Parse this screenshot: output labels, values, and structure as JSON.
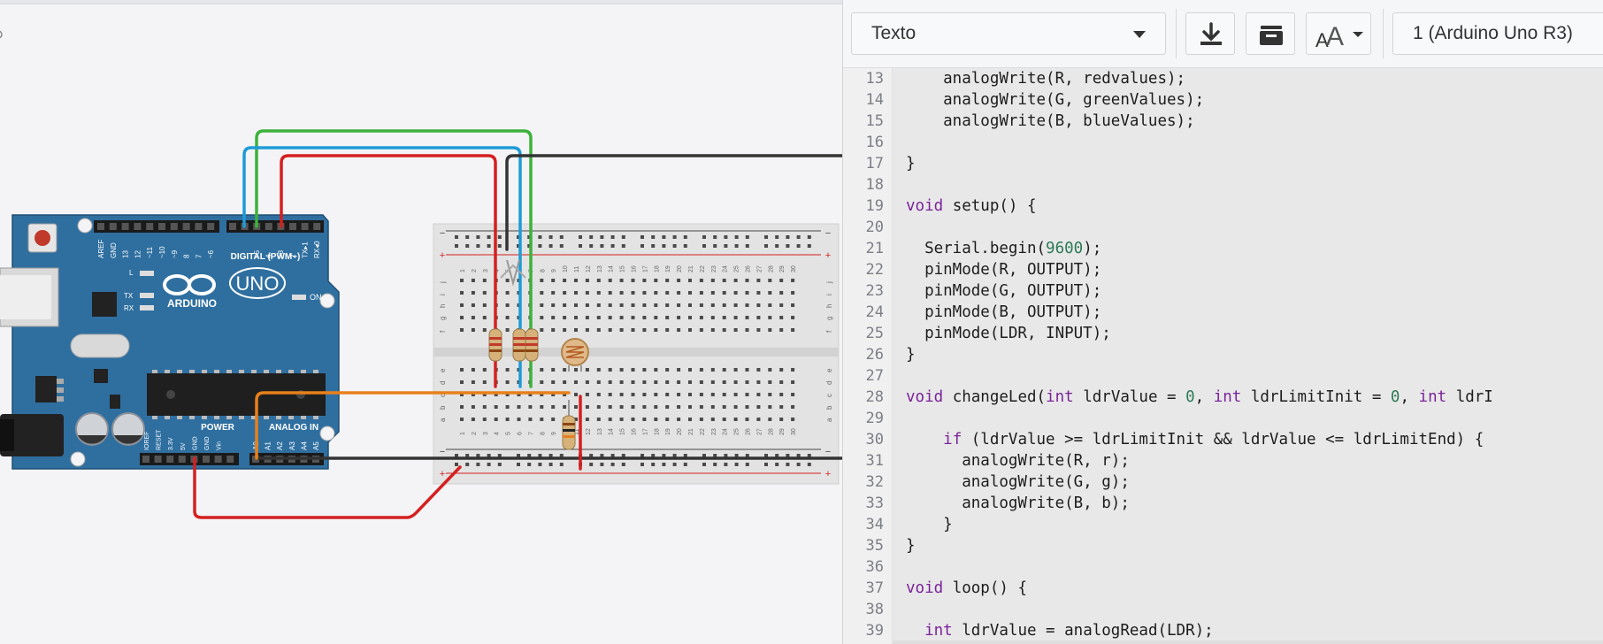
{
  "toolbar": {
    "mode_label": "Texto",
    "device_label": "1 (Arduino Uno R3)",
    "icons": [
      "download-icon",
      "library-icon",
      "font-size-icon"
    ]
  },
  "board": {
    "logo": "ARDUINO",
    "model": "UNO",
    "digital_label": "DIGITAL (PWM~)",
    "power_label": "POWER",
    "analog_label": "ANALOG IN",
    "on_label": "ON",
    "l_label": "L",
    "tx_label": "TX",
    "rx_label": "RX",
    "digital_pins": [
      "AREF",
      "GND",
      "13",
      "12",
      "~11",
      "~10",
      "~9",
      "8",
      "7",
      "~6",
      "~5",
      "4",
      "~3",
      "2",
      "TX▸1",
      "RX◂0"
    ],
    "power_pins": [
      "IOREF",
      "RESET",
      "3.3V",
      "5V",
      "GND",
      "GND",
      "Vin"
    ],
    "analog_pins": [
      "A0",
      "A1",
      "A2",
      "A3",
      "A4",
      "A5"
    ]
  },
  "breadboard": {
    "rows_top": [
      "j",
      "i",
      "h",
      "g",
      "f"
    ],
    "rows_bottom": [
      "e",
      "d",
      "c",
      "b",
      "a"
    ],
    "columns": [
      "1",
      "2",
      "3",
      "4",
      "5",
      "6",
      "7",
      "8",
      "9",
      "10",
      "11",
      "12",
      "13",
      "14",
      "15",
      "16",
      "17",
      "18",
      "19",
      "20",
      "21",
      "22",
      "23",
      "24",
      "25",
      "26",
      "27",
      "28",
      "29",
      "30"
    ],
    "rail_minus": "−",
    "rail_plus": "+"
  },
  "code": {
    "lines": [
      {
        "n": "13",
        "t": "    analogWrite(R, redvalues);"
      },
      {
        "n": "14",
        "t": "    analogWrite(G, greenValues);"
      },
      {
        "n": "15",
        "t": "    analogWrite(B, blueValues);"
      },
      {
        "n": "16",
        "t": ""
      },
      {
        "n": "17",
        "t": "}"
      },
      {
        "n": "18",
        "t": ""
      },
      {
        "n": "19",
        "t": "void setup() {"
      },
      {
        "n": "20",
        "t": ""
      },
      {
        "n": "21",
        "t": "  Serial.begin(9600);"
      },
      {
        "n": "22",
        "t": "  pinMode(R, OUTPUT);"
      },
      {
        "n": "23",
        "t": "  pinMode(G, OUTPUT);"
      },
      {
        "n": "24",
        "t": "  pinMode(B, OUTPUT);"
      },
      {
        "n": "25",
        "t": "  pinMode(LDR, INPUT);"
      },
      {
        "n": "26",
        "t": "}"
      },
      {
        "n": "27",
        "t": ""
      },
      {
        "n": "28",
        "t": "void changeLed(int ldrValue = 0, int ldrLimitInit = 0, int ldrI"
      },
      {
        "n": "29",
        "t": ""
      },
      {
        "n": "30",
        "t": "    if (ldrValue >= ldrLimitInit && ldrValue <= ldrLimitEnd) {"
      },
      {
        "n": "31",
        "t": "      analogWrite(R, r);"
      },
      {
        "n": "32",
        "t": "      analogWrite(G, g);"
      },
      {
        "n": "33",
        "t": "      analogWrite(B, b);"
      },
      {
        "n": "34",
        "t": "    }"
      },
      {
        "n": "35",
        "t": "}"
      },
      {
        "n": "36",
        "t": ""
      },
      {
        "n": "37",
        "t": "void loop() {"
      },
      {
        "n": "38",
        "t": ""
      },
      {
        "n": "39",
        "t": "  int ldrValue = analogRead(LDR);"
      }
    ]
  },
  "colors": {
    "board": "#2f6fa0",
    "wire_red": "#d42020",
    "wire_green": "#3cb23c",
    "wire_blue": "#1e9bd7",
    "wire_black": "#333333",
    "wire_orange": "#e8801a",
    "keyword": "#7a2299",
    "number": "#2d7a57"
  }
}
